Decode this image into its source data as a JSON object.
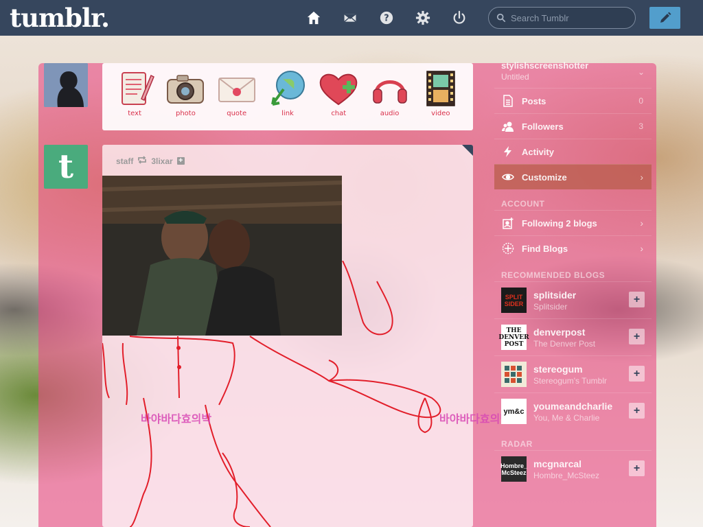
{
  "header": {
    "logo": "tumblr.",
    "search_placeholder": "Search Tumblr"
  },
  "post_types": [
    {
      "label": "text",
      "icon": "text-icon"
    },
    {
      "label": "photo",
      "icon": "camera-icon"
    },
    {
      "label": "quote",
      "icon": "quote-icon"
    },
    {
      "label": "link",
      "icon": "link-icon"
    },
    {
      "label": "chat",
      "icon": "chat-icon"
    },
    {
      "label": "audio",
      "icon": "headphones-icon"
    },
    {
      "label": "video",
      "icon": "film-icon"
    }
  ],
  "post": {
    "author": "staff",
    "reblogged_from": "3lixar"
  },
  "watermark_text": "바야바다효의박",
  "sidebar": {
    "blog_name": "stylishscreenshotter",
    "blog_title": "Untitled",
    "items": [
      {
        "label": "Posts",
        "count": "0"
      },
      {
        "label": "Followers",
        "count": "3"
      },
      {
        "label": "Activity",
        "count": ""
      },
      {
        "label": "Customize",
        "count": ""
      }
    ],
    "account_heading": "ACCOUNT",
    "account_items": [
      {
        "label": "Following 2 blogs"
      },
      {
        "label": "Find Blogs"
      }
    ],
    "recommended_heading": "RECOMMENDED BLOGS",
    "recommended": [
      {
        "name": "splitsider",
        "title": "Splitsider",
        "thumb": "SPLIT SIDER"
      },
      {
        "name": "denverpost",
        "title": "The Denver Post",
        "thumb": "THE DENVER POST"
      },
      {
        "name": "stereogum",
        "title": "Stereogum's Tumblr",
        "thumb": ""
      },
      {
        "name": "youmeandcharlie",
        "title": "You, Me & Charlie",
        "thumb": "ym&c"
      }
    ],
    "radar_heading": "RADAR",
    "radar": [
      {
        "name": "mcgnarcal",
        "title": "Hombre_McSteez",
        "thumb": "Hombre_ McSteez"
      }
    ]
  }
}
